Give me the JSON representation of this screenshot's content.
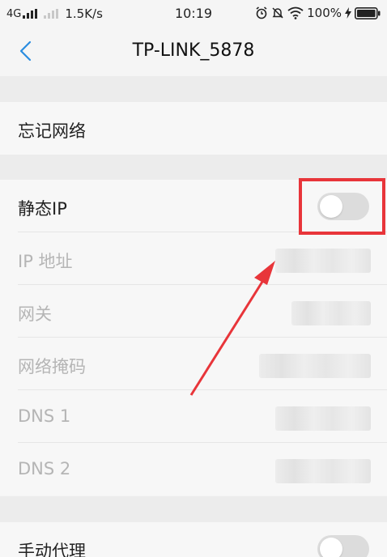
{
  "status_bar": {
    "network_type": "4G",
    "speed": "1.5K/s",
    "time": "10:19",
    "battery": "100%"
  },
  "nav": {
    "title": "TP-LINK_5878"
  },
  "forget_group": {
    "forget_label": "忘记网络"
  },
  "ip_group": {
    "static_ip_label": "静态IP",
    "static_ip_on": false,
    "ip_address_label": "IP 地址",
    "gateway_label": "网关",
    "netmask_label": "网络掩码",
    "dns1_label": "DNS 1",
    "dns2_label": "DNS 2"
  },
  "proxy_group": {
    "manual_proxy_label": "手动代理",
    "manual_proxy_on": false
  },
  "annotation": {
    "color": "#e8353a"
  }
}
